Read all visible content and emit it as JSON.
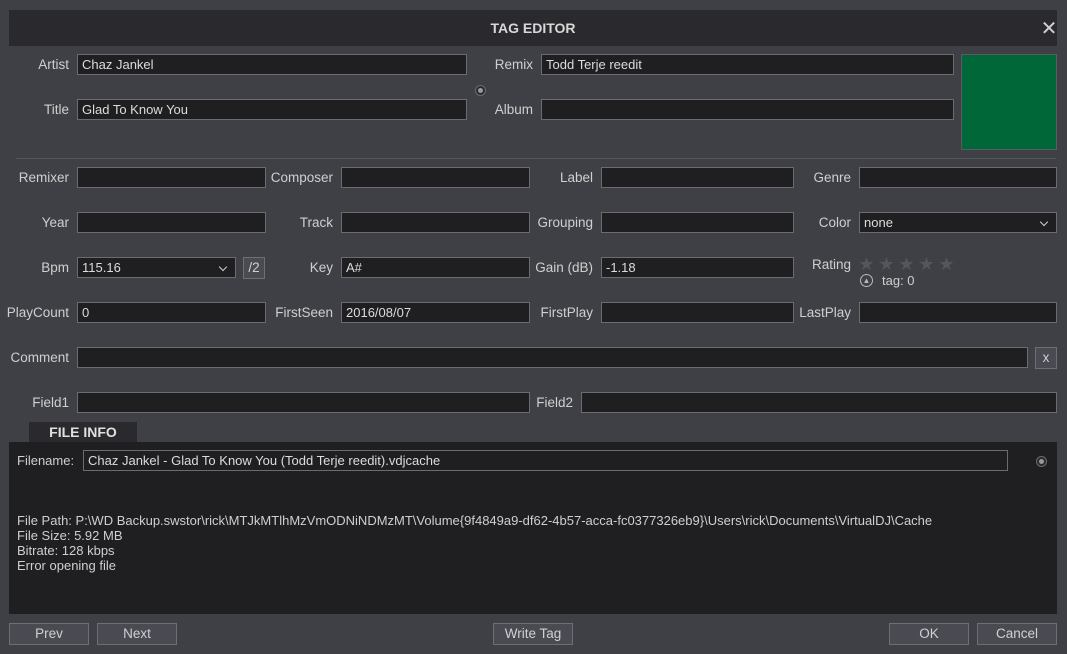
{
  "window": {
    "title": "TAG EDITOR",
    "close_glyph": "✕"
  },
  "fields": {
    "artist": {
      "label": "Artist",
      "value": "Chaz Jankel"
    },
    "title": {
      "label": "Title",
      "value": "Glad To Know You"
    },
    "remix": {
      "label": "Remix",
      "value": "Todd Terje reedit"
    },
    "album": {
      "label": "Album",
      "value": ""
    },
    "remixer": {
      "label": "Remixer",
      "value": ""
    },
    "composer": {
      "label": "Composer",
      "value": ""
    },
    "label": {
      "label": "Label",
      "value": ""
    },
    "genre": {
      "label": "Genre",
      "value": ""
    },
    "year": {
      "label": "Year",
      "value": ""
    },
    "track": {
      "label": "Track",
      "value": ""
    },
    "grouping": {
      "label": "Grouping",
      "value": ""
    },
    "color": {
      "label": "Color",
      "value": "none"
    },
    "bpm": {
      "label": "Bpm",
      "value": "115.16",
      "half_button": "/2"
    },
    "key": {
      "label": "Key",
      "value": "A#"
    },
    "gain": {
      "label": "Gain (dB)",
      "value": "-1.18"
    },
    "rating": {
      "label": "Rating",
      "stars": 0,
      "max_stars": 5,
      "tag_label": "tag: 0"
    },
    "playcount": {
      "label": "PlayCount",
      "value": "0"
    },
    "firstseen": {
      "label": "FirstSeen",
      "value": "2016/08/07"
    },
    "firstplay": {
      "label": "FirstPlay",
      "value": ""
    },
    "lastplay": {
      "label": "LastPlay",
      "value": ""
    },
    "comment": {
      "label": "Comment",
      "value": "",
      "clear_button": "x"
    },
    "field1": {
      "label": "Field1",
      "value": ""
    },
    "field2": {
      "label": "Field2",
      "value": ""
    }
  },
  "cover_color": "#006838",
  "file_info": {
    "tab_label": "FILE INFO",
    "filename_label": "Filename:",
    "filename": "Chaz Jankel - Glad To Know You (Todd Terje reedit).vdjcache",
    "file_path": "File Path: P:\\WD Backup.swstor\\rick\\MTJkMTlhMzVmODNiNDMzMT\\Volume{9f4849a9-df62-4b57-acca-fc0377326eb9}\\Users\\rick\\Documents\\VirtualDJ\\Cache",
    "file_size": "File Size: 5.92 MB",
    "bitrate": "Bitrate: 128 kbps",
    "error": "Error opening file"
  },
  "buttons": {
    "prev": "Prev",
    "next": "Next",
    "write_tag": "Write Tag",
    "ok": "OK",
    "cancel": "Cancel"
  }
}
